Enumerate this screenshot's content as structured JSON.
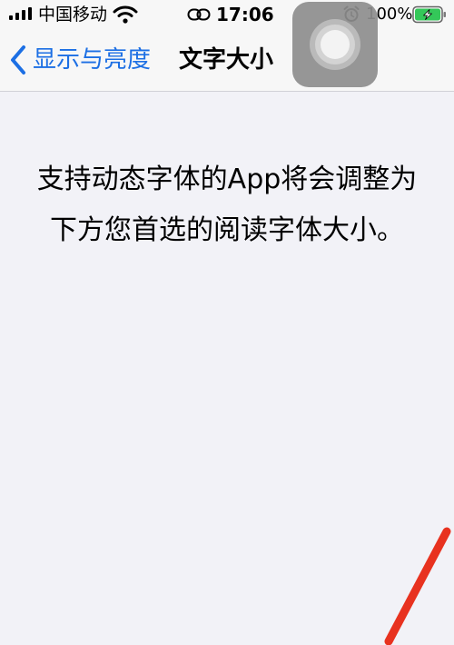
{
  "status_bar": {
    "carrier": "中国移动",
    "time": "17:06",
    "battery_percent": "100%",
    "icons": [
      "signal-icon",
      "wifi-icon",
      "link-icon",
      "alarm-icon",
      "battery-charging-icon"
    ]
  },
  "nav": {
    "back_label": "显示与亮度",
    "title": "文字大小"
  },
  "main": {
    "description": "支持动态字体的App将会调整为下方您首选的阅读字体大小。"
  },
  "colors": {
    "accent": "#1c6fe4",
    "background": "#f2f2f7",
    "bar": "#f7f7f7",
    "battery": "#34c759",
    "annotation": "#e8321f"
  }
}
